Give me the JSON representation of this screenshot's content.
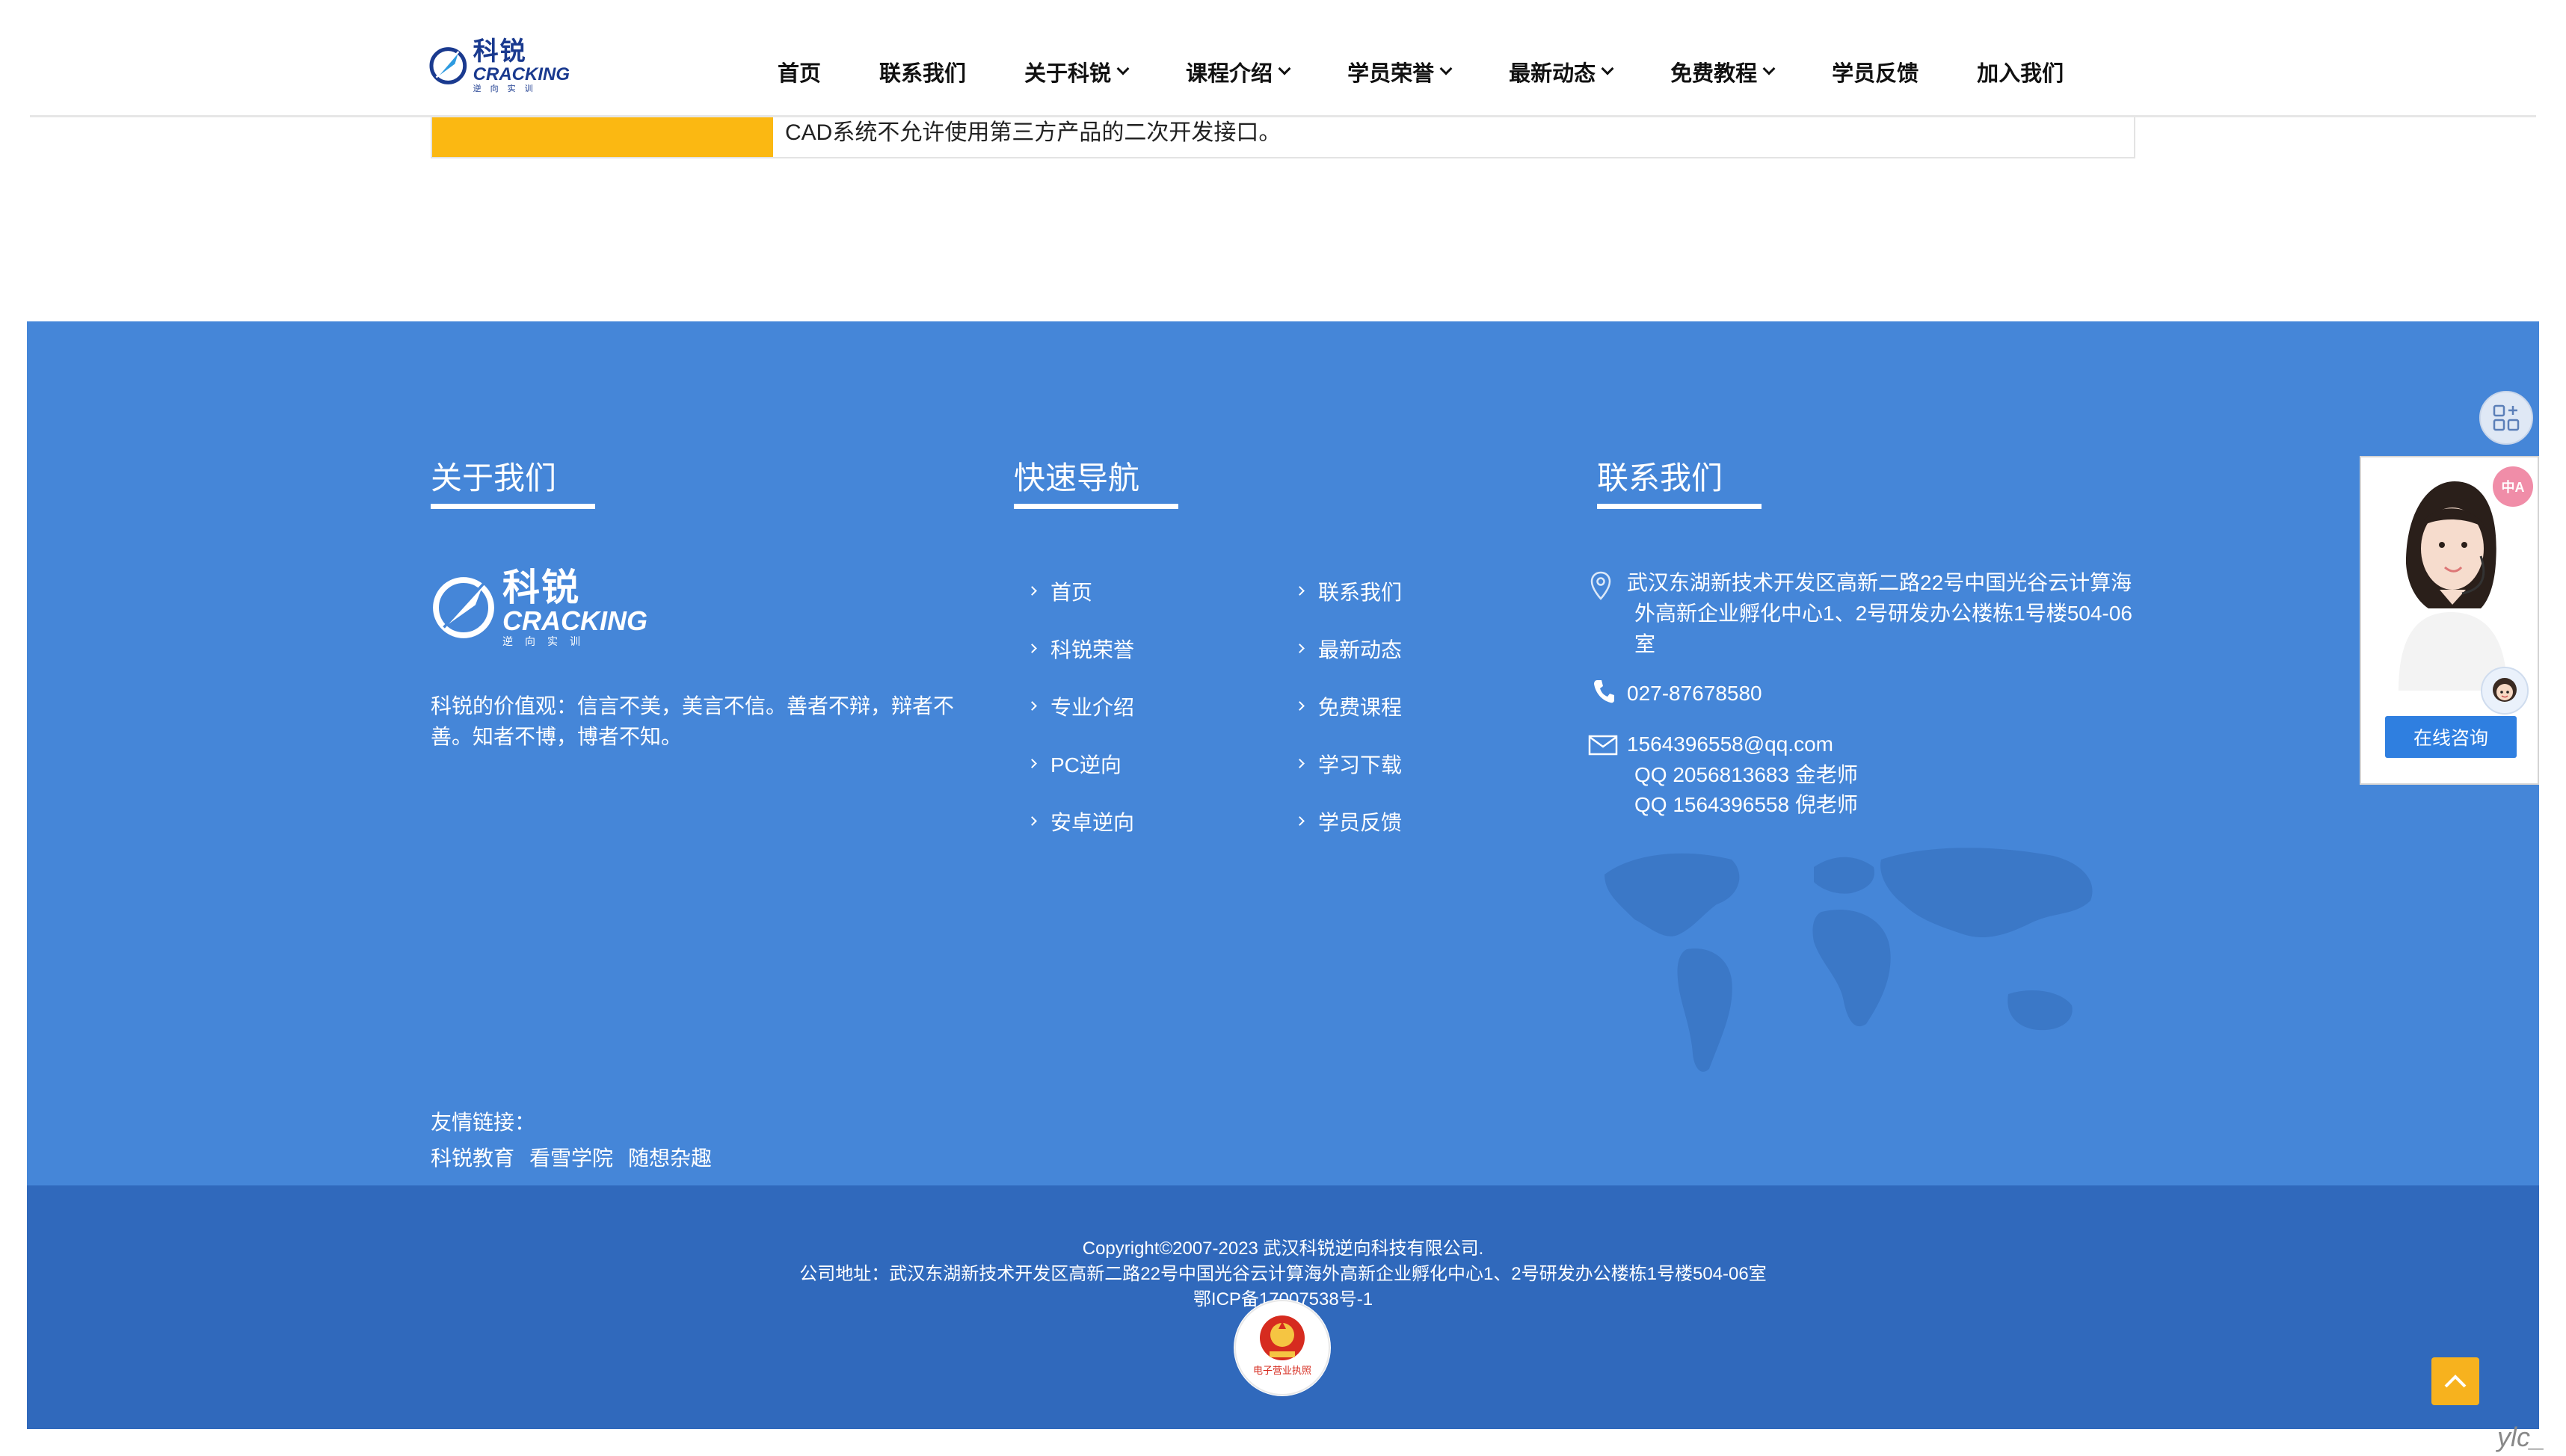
{
  "header": {
    "logo": {
      "cn": "科锐",
      "en": "CRACKING",
      "sub": "逆向实训"
    },
    "nav": [
      {
        "label": "首页",
        "dropdown": false
      },
      {
        "label": "联系我们",
        "dropdown": false
      },
      {
        "label": "关于科锐",
        "dropdown": true
      },
      {
        "label": "课程介绍",
        "dropdown": true
      },
      {
        "label": "学员荣誉",
        "dropdown": true
      },
      {
        "label": "最新动态",
        "dropdown": true
      },
      {
        "label": "免费教程",
        "dropdown": true
      },
      {
        "label": "学员反馈",
        "dropdown": false
      },
      {
        "label": "加入我们",
        "dropdown": false
      }
    ]
  },
  "content": {
    "row_text": "CAD系统不允许使用第三方产品的二次开发接口。"
  },
  "footer": {
    "about": {
      "title": "关于我们",
      "logo": {
        "cn": "科锐",
        "en": "CRACKING",
        "sub": "逆向实训"
      },
      "values": "科锐的价值观：信言不美，美言不信。善者不辩，辩者不善。知者不博，博者不知。"
    },
    "quicknav": {
      "title": "快速导航",
      "items": [
        "首页",
        "联系我们",
        "科锐荣誉",
        "最新动态",
        "专业介绍",
        "免费课程",
        "PC逆向",
        "学习下载",
        "安卓逆向",
        "学员反馈"
      ]
    },
    "contact": {
      "title": "联系我们",
      "address_lines": [
        "武汉东湖新技术开发区高新二路22号中国光谷云计算海",
        "外高新企业孵化中心1、2号研发办公楼栋1号楼504-06",
        "室"
      ],
      "phone": "027-87678580",
      "email": "1564396558@qq.com",
      "qq_lines": [
        "QQ 2056813683 金老师",
        "QQ 1564396558 倪老师"
      ]
    },
    "links": {
      "label": "友情链接：",
      "items": [
        "科锐教育",
        "看雪学院",
        "随想杂趣"
      ]
    },
    "copyright": {
      "line1": "Copyright©2007-2023 武汉科锐逆向科技有限公司.",
      "line2": "公司地址：武汉东湖新技术开发区高新二路22号中国光谷云计算海外高新企业孵化中心1、2号研发办公楼栋1号楼504-06室",
      "line3": "鄂ICP备17007538号-1",
      "badge_text": "电子营业执照"
    }
  },
  "widgets": {
    "consult_button": "在线咨询",
    "badge_icon_text": "中A",
    "corner_text": "ylc_"
  },
  "colors": {
    "footer_blue": "#4586d8",
    "footer_bottom_blue": "#3069bc",
    "accent_yellow": "#fbb812",
    "consult_blue": "#2f7fe0"
  }
}
